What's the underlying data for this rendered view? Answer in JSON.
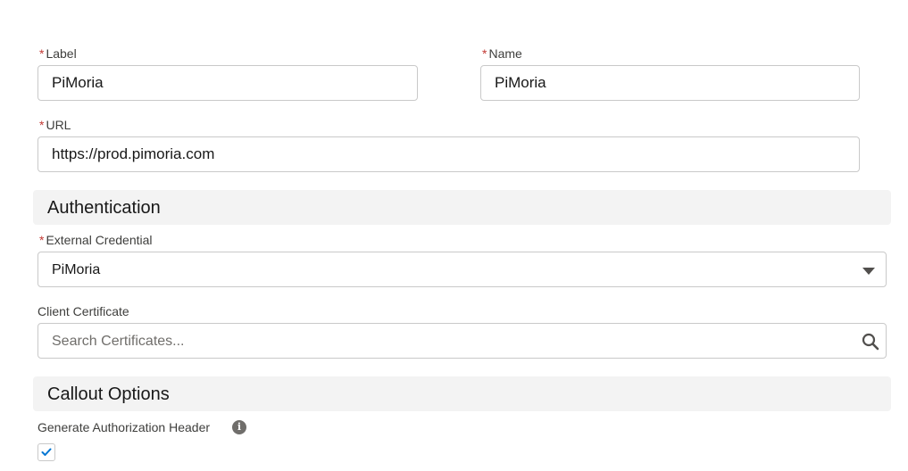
{
  "fields": {
    "label": {
      "required_mark": "*",
      "label": "Label",
      "value": "PiMoria"
    },
    "name": {
      "required_mark": "*",
      "label": "Name",
      "value": "PiMoria"
    },
    "url": {
      "required_mark": "*",
      "label": "URL",
      "value": "https://prod.pimoria.com"
    }
  },
  "authentication": {
    "heading": "Authentication",
    "external_credential": {
      "required_mark": "*",
      "label": "External Credential",
      "value": "PiMoria",
      "icon": "chevron-down-icon"
    },
    "client_certificate": {
      "label": "Client Certificate",
      "placeholder": "Search Certificates...",
      "icon": "search-icon"
    }
  },
  "callout_options": {
    "heading": "Callout Options",
    "generate_auth_header": {
      "label": "Generate Authorization Header",
      "info_icon": "info-icon",
      "checked": true
    }
  },
  "colors": {
    "required": "#c23934",
    "section_bg": "#f3f3f3",
    "checkmark": "#0176d3",
    "border": "#c9c9c9"
  }
}
